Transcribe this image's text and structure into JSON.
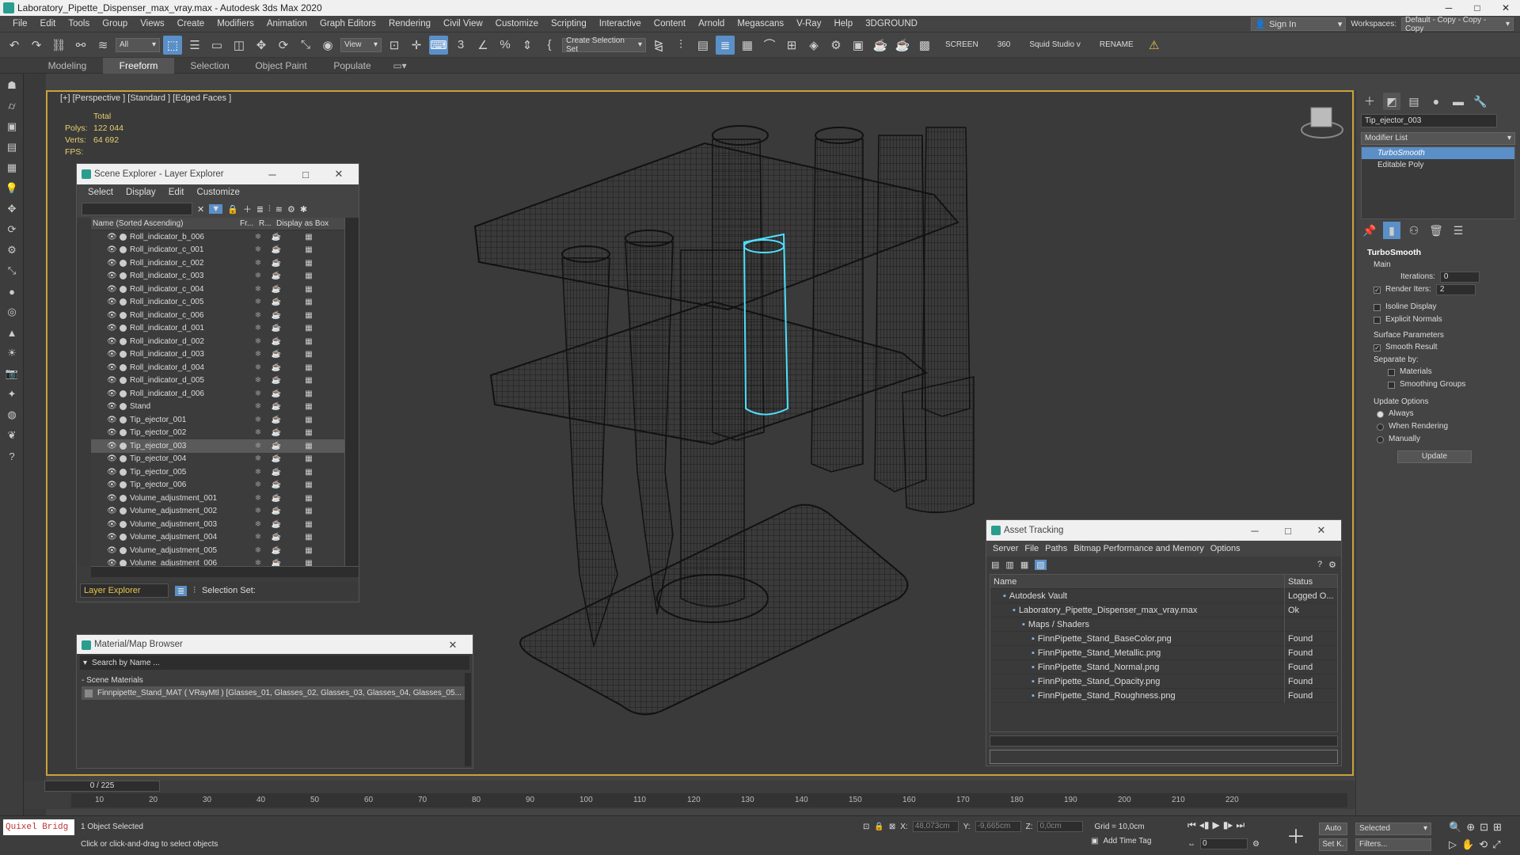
{
  "title_bar": {
    "title": "Laboratory_Pipette_Dispenser_max_vray.max - Autodesk 3ds Max 2020",
    "min": "─",
    "max": "□",
    "close": "✕"
  },
  "menu": [
    "File",
    "Edit",
    "Tools",
    "Group",
    "Views",
    "Create",
    "Modifiers",
    "Animation",
    "Graph Editors",
    "Rendering",
    "Civil View",
    "Customize",
    "Scripting",
    "Interactive",
    "Content",
    "Arnold",
    "Megascans",
    "V-Ray",
    "Help",
    "3DGROUND"
  ],
  "sign_in": "Sign In",
  "workspaces_label": "Workspaces:",
  "workspace_value": "Default - Copy - Copy - Copy",
  "toolbar": {
    "filter": "All",
    "view": "View",
    "selection_set": "Create Selection Set",
    "screen": "SCREEN",
    "deg": "360",
    "studio": "Squid Studio v",
    "rename": "RENAME"
  },
  "ribbon_tabs": [
    "Modeling",
    "Freeform",
    "Selection",
    "Object Paint",
    "Populate"
  ],
  "viewport": {
    "label": "[+] [Perspective ] [Standard ] [Edged Faces ]",
    "stats_total": "Total",
    "polys_label": "Polys:",
    "polys": "122 044",
    "verts_label": "Verts:",
    "verts": "64 692",
    "fps_label": "FPS:"
  },
  "scene_explorer": {
    "title": "Scene Explorer - Layer Explorer",
    "menu": [
      "Select",
      "Display",
      "Edit",
      "Customize"
    ],
    "col_name": "Name (Sorted Ascending)",
    "col_fr": "Fr...",
    "col_r": "R...",
    "col_box": "Display as Box",
    "rows": [
      "Roll_indicator_b_006",
      "Roll_indicator_c_001",
      "Roll_indicator_c_002",
      "Roll_indicator_c_003",
      "Roll_indicator_c_004",
      "Roll_indicator_c_005",
      "Roll_indicator_c_006",
      "Roll_indicator_d_001",
      "Roll_indicator_d_002",
      "Roll_indicator_d_003",
      "Roll_indicator_d_004",
      "Roll_indicator_d_005",
      "Roll_indicator_d_006",
      "Stand",
      "Tip_ejector_001",
      "Tip_ejector_002",
      "Tip_ejector_003",
      "Tip_ejector_004",
      "Tip_ejector_005",
      "Tip_ejector_006",
      "Volume_adjustment_001",
      "Volume_adjustment_002",
      "Volume_adjustment_003",
      "Volume_adjustment_004",
      "Volume_adjustment_005",
      "Volume_adjustment_006"
    ],
    "selected_row": "Tip_ejector_003",
    "layer_explorer": "Layer Explorer",
    "selection_set": "Selection Set:"
  },
  "material_browser": {
    "title": "Material/Map Browser",
    "search": "Search by Name ...",
    "section": "- Scene Materials",
    "item": "Finnpipette_Stand_MAT  ( VRayMtl )  [Glasses_01, Glasses_02, Glasses_03, Glasses_04, Glasses_05..."
  },
  "asset_tracking": {
    "title": "Asset Tracking",
    "menu": [
      "Server",
      "File",
      "Paths",
      "Bitmap Performance and Memory",
      "Options"
    ],
    "col_name": "Name",
    "col_status": "Status",
    "rows": [
      {
        "name": "Autodesk Vault",
        "status": "Logged O...",
        "indent": 1
      },
      {
        "name": "Laboratory_Pipette_Dispenser_max_vray.max",
        "status": "Ok",
        "indent": 2
      },
      {
        "name": "Maps / Shaders",
        "status": "",
        "indent": 3
      },
      {
        "name": "FinnPipette_Stand_BaseColor.png",
        "status": "Found",
        "indent": 4
      },
      {
        "name": "FinnPipette_Stand_Metallic.png",
        "status": "Found",
        "indent": 4
      },
      {
        "name": "FinnPipette_Stand_Normal.png",
        "status": "Found",
        "indent": 4
      },
      {
        "name": "FinnPipette_Stand_Opacity.png",
        "status": "Found",
        "indent": 4
      },
      {
        "name": "FinnPipette_Stand_Roughness.png",
        "status": "Found",
        "indent": 4
      }
    ]
  },
  "command_panel": {
    "object_name": "Tip_ejector_003",
    "modifier_list": "Modifier List",
    "stack": [
      "TurboSmooth",
      "Editable Poly"
    ],
    "rollout": "TurboSmooth",
    "main": "Main",
    "iterations_label": "Iterations:",
    "iterations": "0",
    "render_iters_label": "Render Iters:",
    "render_iters": "2",
    "isoline": "Isoline Display",
    "explicit": "Explicit Normals",
    "surface": "Surface Parameters",
    "smooth": "Smooth Result",
    "separate": "Separate by:",
    "materials": "Materials",
    "smoothing": "Smoothing Groups",
    "update_opts": "Update Options",
    "always": "Always",
    "when_rendering": "When Rendering",
    "manually": "Manually",
    "update": "Update"
  },
  "timeline": {
    "frame": "0 / 225",
    "ticks": [
      "10",
      "20",
      "30",
      "40",
      "50",
      "60",
      "70",
      "80",
      "90",
      "100",
      "110",
      "120",
      "130",
      "140",
      "150",
      "160",
      "170",
      "180",
      "190",
      "200",
      "210",
      "220"
    ]
  },
  "status": {
    "quixel": "Quixel Bridg",
    "selected": "1 Object Selected",
    "hint": "Click or click-and-drag to select objects",
    "x_label": "X:",
    "x": "48,073cm",
    "y_label": "Y:",
    "y": "-9,665cm",
    "z_label": "Z:",
    "z": "0,0cm",
    "grid": "Grid = 10,0cm",
    "add_time_tag": "Add Time Tag",
    "auto": "Auto",
    "selected_dd": "Selected",
    "set_k": "Set K.",
    "filters": "Filters...",
    "frame_field": "0"
  },
  "colors": {
    "selection": "#5b8fc7",
    "viewport_border": "#c8a23a",
    "selected_wire": "#4fe0ff"
  }
}
